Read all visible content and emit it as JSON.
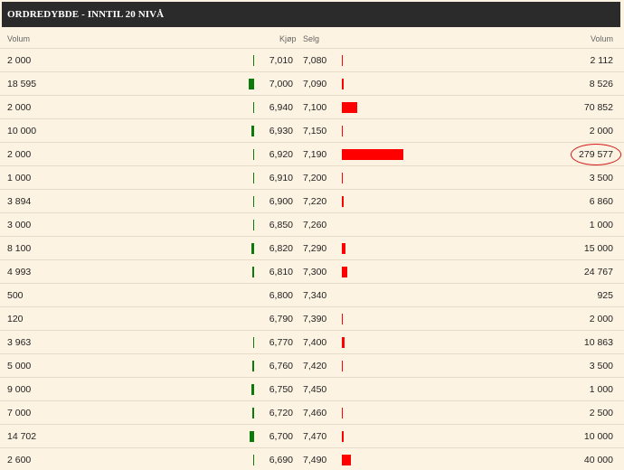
{
  "header": {
    "title": "ORDREDYBDE - INNTIL 20 NIVÅ"
  },
  "columns": {
    "buy_volume": "Volum",
    "buy_price": "Kjøp",
    "sell_price": "Selg",
    "sell_volume": "Volum"
  },
  "colors": {
    "buy_bar": "#0a7a0a",
    "sell_bar": "#ff0000",
    "highlight": "#d21a1a"
  },
  "rows": [
    {
      "buy_volume": "2 000",
      "buy_price": "7,010",
      "sell_price": "7,080",
      "sell_volume": "2 112"
    },
    {
      "buy_volume": "18 595",
      "buy_price": "7,000",
      "sell_price": "7,090",
      "sell_volume": "8 526"
    },
    {
      "buy_volume": "2 000",
      "buy_price": "6,940",
      "sell_price": "7,100",
      "sell_volume": "70 852"
    },
    {
      "buy_volume": "10 000",
      "buy_price": "6,930",
      "sell_price": "7,150",
      "sell_volume": "2 000"
    },
    {
      "buy_volume": "2 000",
      "buy_price": "6,920",
      "sell_price": "7,190",
      "sell_volume": "279 577",
      "highlighted": true
    },
    {
      "buy_volume": "1 000",
      "buy_price": "6,910",
      "sell_price": "7,200",
      "sell_volume": "3 500"
    },
    {
      "buy_volume": "3 894",
      "buy_price": "6,900",
      "sell_price": "7,220",
      "sell_volume": "6 860"
    },
    {
      "buy_volume": "3 000",
      "buy_price": "6,850",
      "sell_price": "7,260",
      "sell_volume": "1 000"
    },
    {
      "buy_volume": "8 100",
      "buy_price": "6,820",
      "sell_price": "7,290",
      "sell_volume": "15 000"
    },
    {
      "buy_volume": "4 993",
      "buy_price": "6,810",
      "sell_price": "7,300",
      "sell_volume": "24 767"
    },
    {
      "buy_volume": "500",
      "buy_price": "6,800",
      "sell_price": "7,340",
      "sell_volume": "925"
    },
    {
      "buy_volume": "120",
      "buy_price": "6,790",
      "sell_price": "7,390",
      "sell_volume": "2 000"
    },
    {
      "buy_volume": "3 963",
      "buy_price": "6,770",
      "sell_price": "7,400",
      "sell_volume": "10 863"
    },
    {
      "buy_volume": "5 000",
      "buy_price": "6,760",
      "sell_price": "7,420",
      "sell_volume": "3 500"
    },
    {
      "buy_volume": "9 000",
      "buy_price": "6,750",
      "sell_price": "7,450",
      "sell_volume": "1 000"
    },
    {
      "buy_volume": "7 000",
      "buy_price": "6,720",
      "sell_price": "7,460",
      "sell_volume": "2 500"
    },
    {
      "buy_volume": "14 702",
      "buy_price": "6,700",
      "sell_price": "7,470",
      "sell_volume": "10 000"
    },
    {
      "buy_volume": "2 600",
      "buy_price": "6,690",
      "sell_price": "7,490",
      "sell_volume": "40 000"
    }
  ]
}
